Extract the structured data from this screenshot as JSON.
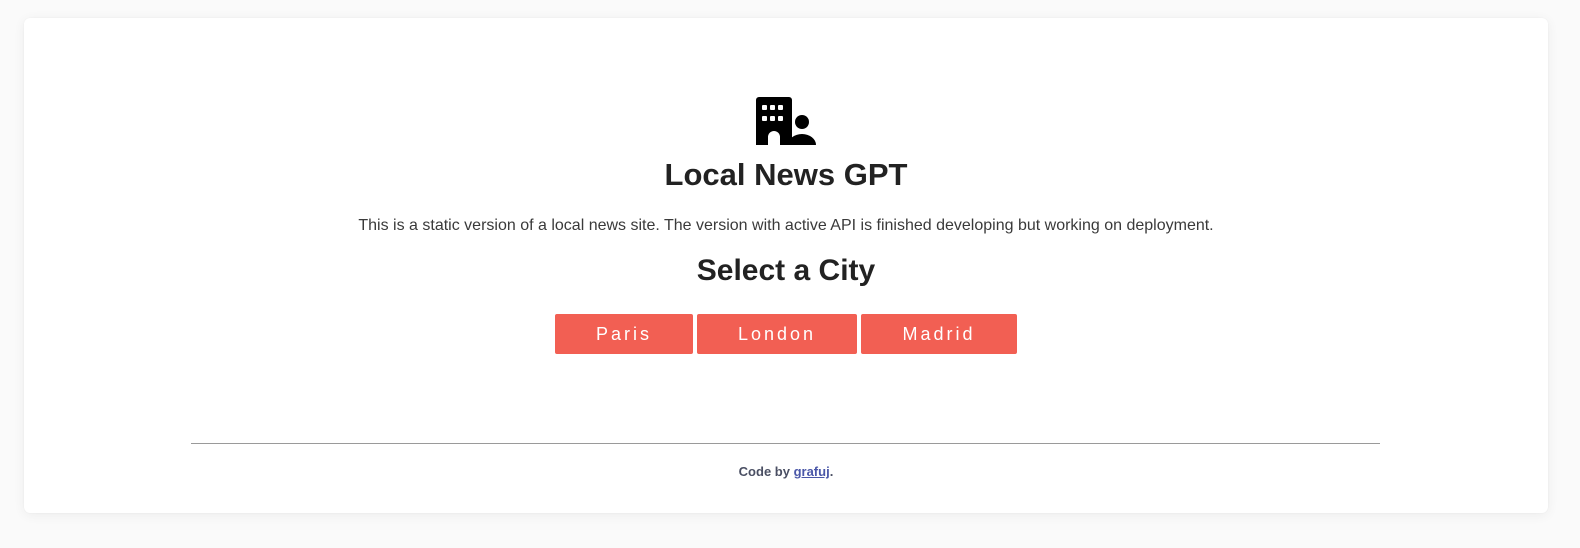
{
  "header": {
    "logo_icon": "building-user-icon",
    "title": "Local News GPT",
    "description": "This is a static version of a local news site. The version with active API is finished developing but working on deployment."
  },
  "city_selector": {
    "heading": "Select a City",
    "cities": [
      {
        "label": "Paris"
      },
      {
        "label": "London"
      },
      {
        "label": "Madrid"
      }
    ],
    "button_color": "#f25f53"
  },
  "footer": {
    "prefix": "Code by ",
    "author_link": "grafuj",
    "suffix": "."
  }
}
